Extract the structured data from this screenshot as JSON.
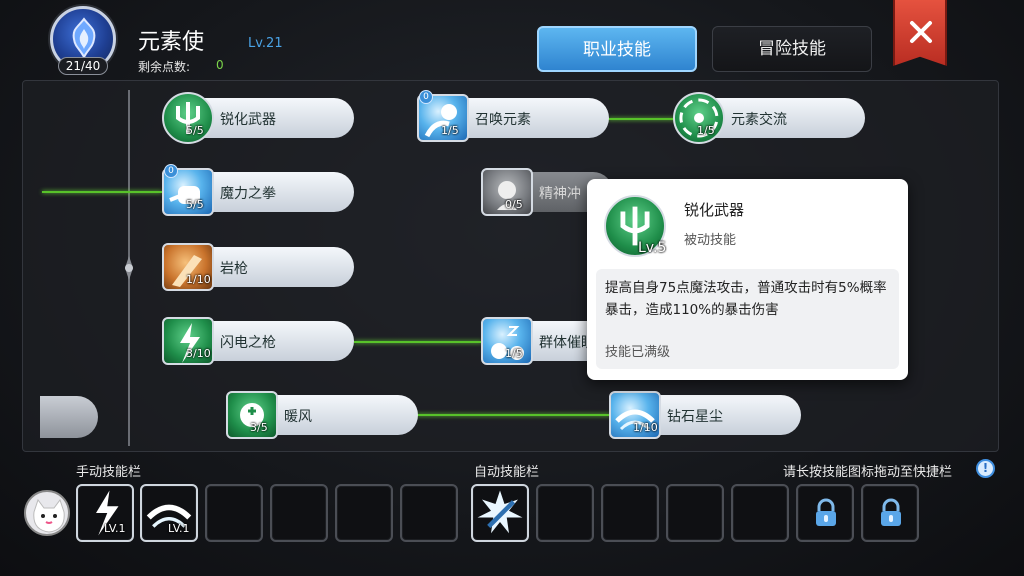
{
  "header": {
    "class_name": "元素使",
    "class_level": "Lv.21",
    "skill_points_used": "21/40",
    "remaining_points_label": "剩余点数:",
    "remaining_points_value": "0"
  },
  "tabs": [
    {
      "label": "职业技能",
      "active": true
    },
    {
      "label": "冒险技能",
      "active": false
    }
  ],
  "colors": {
    "accent": "#3a9ae4",
    "link_line": "#58c22a",
    "close": "#d6402f"
  },
  "skills": [
    {
      "name": "锐化武器",
      "level": "5/5",
      "icon": "trident-icon"
    },
    {
      "name": "召唤元素",
      "level": "1/5",
      "icon": "summon-icon",
      "badge": "0"
    },
    {
      "name": "元素交流",
      "level": "1/5",
      "icon": "elements-icon"
    },
    {
      "name": "魔力之拳",
      "level": "5/5",
      "icon": "fist-icon",
      "badge": "0"
    },
    {
      "name": "精神冲击",
      "level": "0/5",
      "icon": "spirit-icon",
      "visible_label": "精神冲"
    },
    {
      "name": "岩枪",
      "level": "1/10",
      "icon": "rock-spear-icon"
    },
    {
      "name": "闪电之枪",
      "level": "3/10",
      "icon": "lightning-spear-icon"
    },
    {
      "name": "群体催眠",
      "level": "1/5",
      "icon": "mass-sleep-icon",
      "visible_label": "群体催眠"
    },
    {
      "name": "暖风",
      "level": "3/5",
      "icon": "warm-wind-icon"
    },
    {
      "name": "钻石星尘",
      "level": "1/10",
      "icon": "diamond-dust-icon"
    }
  ],
  "tooltip": {
    "name": "锐化武器",
    "level": "Lv.5",
    "type": "被动技能",
    "description": "提高自身75点魔法攻击，普通攻击时有5%概率暴击，造成110%的暴击伤害",
    "status": "技能已满级"
  },
  "bottom": {
    "manual_label": "手动技能栏",
    "auto_label": "自动技能栏",
    "hint": "请长按技能图标拖动至快捷栏",
    "manual_slots": [
      {
        "level": "LV.1",
        "icon": "lightning-spear-icon"
      },
      {
        "level": "LV.1",
        "icon": "diamond-dust-icon"
      },
      {},
      {},
      {},
      {}
    ],
    "auto_slots": [
      {
        "icon": "sword-burst-icon"
      },
      {},
      {},
      {},
      {},
      {
        "locked": true
      },
      {
        "locked": true
      }
    ]
  }
}
